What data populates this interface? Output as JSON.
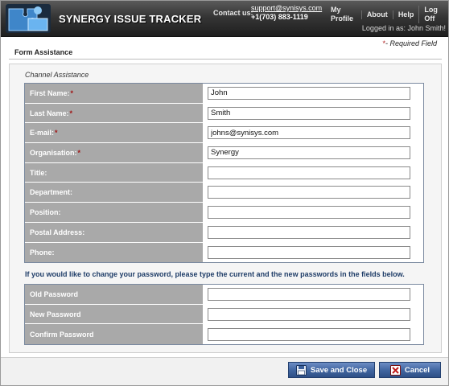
{
  "header": {
    "app_title": "SYNERGY ISSUE TRACKER",
    "contact_label": "Contact us:",
    "contact_email": "support@synisys.com",
    "contact_phone": "+1(703) 883-1119",
    "nav": [
      "My Profile",
      "About",
      "Help",
      "Log Off"
    ],
    "logged_in_text": "Logged in as:  John Smith!"
  },
  "page": {
    "required_star": "*",
    "required_note": "- Required Field",
    "form_title": "Form Assistance",
    "section_label": "Channel Assistance",
    "password_note": "If you would like to change your password, please type the current and the new passwords in the fields below."
  },
  "fields": [
    {
      "label": "First Name:",
      "required": true,
      "value": "John"
    },
    {
      "label": "Last Name:",
      "required": true,
      "value": "Smith"
    },
    {
      "label": "E-mail:",
      "required": true,
      "value": "johns@synisys.com"
    },
    {
      "label": "Organisation:",
      "required": true,
      "value": "Synergy"
    },
    {
      "label": "Title:",
      "required": false,
      "value": ""
    },
    {
      "label": "Department:",
      "required": false,
      "value": ""
    },
    {
      "label": "Position:",
      "required": false,
      "value": ""
    },
    {
      "label": "Postal Address:",
      "required": false,
      "value": ""
    },
    {
      "label": "Phone:",
      "required": false,
      "value": ""
    }
  ],
  "password_fields": [
    {
      "label": "Old Password",
      "value": ""
    },
    {
      "label": "New Password",
      "value": ""
    },
    {
      "label": "Confirm Password",
      "value": ""
    }
  ],
  "buttons": {
    "save_label": "Save and Close",
    "cancel_label": "Cancel"
  },
  "icons": {
    "logo": "puzzle-logo-icon",
    "save": "floppy-disk-icon",
    "cancel": "close-x-icon"
  },
  "colors": {
    "header_bg": "#2a2a2a",
    "label_bg": "#a9a9a9",
    "required_star": "#a11717",
    "note_text": "#1f3d68",
    "button_bg": "#3f649f"
  }
}
